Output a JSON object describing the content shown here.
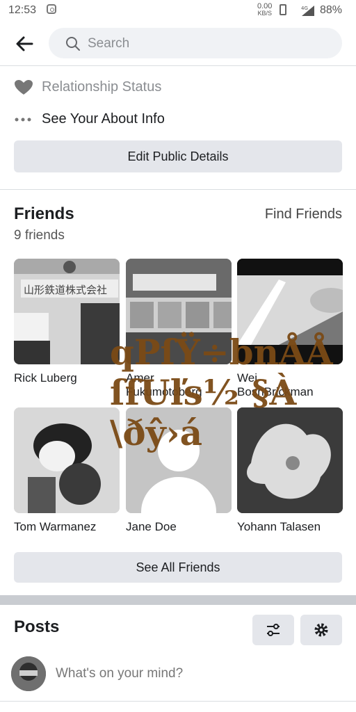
{
  "status_bar": {
    "time": "12:53",
    "net_speed": "0.00",
    "net_unit": "KB/S",
    "network": "4G",
    "battery": "88%"
  },
  "search": {
    "placeholder": "Search"
  },
  "about": {
    "relationship": "Relationship Status",
    "see_about": "See Your About Info",
    "edit_button": "Edit Public Details"
  },
  "friends": {
    "title": "Friends",
    "find_link": "Find Friends",
    "count": "9 friends",
    "list": [
      {
        "name": "Rick Luberg",
        "sign": "山形鉄道株式会社"
      },
      {
        "name": "Amer Fukumotoberg"
      },
      {
        "name": "Wei BosnBrickman"
      },
      {
        "name": "Tom Warmanez"
      },
      {
        "name": "Jane Doe"
      },
      {
        "name": "Yohann Talasen"
      }
    ],
    "see_all": "See All Friends"
  },
  "overlay_text": [
    "qPſŸ÷bnÅÅ",
    "ſſUľs½ §À",
    "\\ðŷ›á"
  ],
  "posts": {
    "title": "Posts",
    "composer_placeholder": "What's on your mind?"
  },
  "colors": {
    "overlay": "#7b4a16",
    "button_bg": "#e4e6eb",
    "divider": "#c9ccd1"
  }
}
